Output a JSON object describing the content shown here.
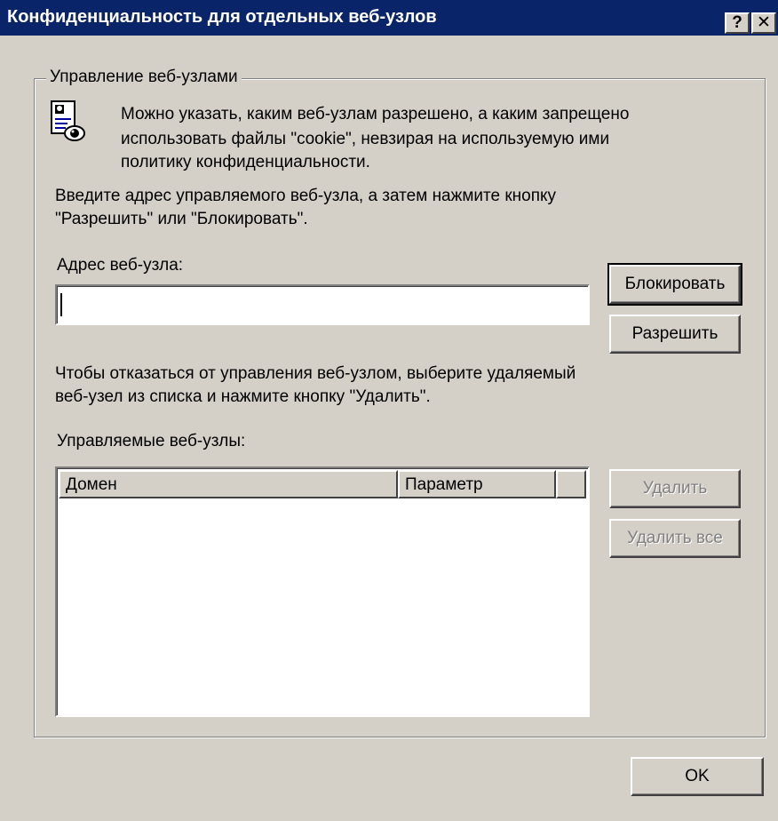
{
  "window": {
    "title": "Конфиденциальность для отдельных веб-узлов",
    "help_button": "?",
    "close_button": "✕"
  },
  "group": {
    "label": "Управление веб-узлами",
    "intro_lines": [
      "Можно указать, каким веб-узлам разрешено, а каким запрещено",
      "использовать файлы \"cookie\", невзирая на используемую ими",
      "политику конфиденциальности."
    ],
    "instruction_lines": [
      "Введите адрес управляемого веб-узла, а затем нажмите кнопку",
      "\"Разрешить\" или \"Блокировать\"."
    ],
    "address_label": "Адрес веб-узла:",
    "address_value": "",
    "remove_info_lines": [
      "Чтобы отказаться от управления веб-узлом, выберите удаляемый",
      "веб-узел из списка и нажмите кнопку \"Удалить\"."
    ],
    "managed_label": "Управляемые веб-узлы:",
    "columns": [
      "Домен",
      "Параметр"
    ],
    "rows": []
  },
  "buttons": {
    "block": "Блокировать",
    "allow": "Разрешить",
    "remove": "Удалить",
    "remove_all": "Удалить все",
    "ok": "OK"
  },
  "icons": {
    "privacy": "privacy-report-icon"
  }
}
